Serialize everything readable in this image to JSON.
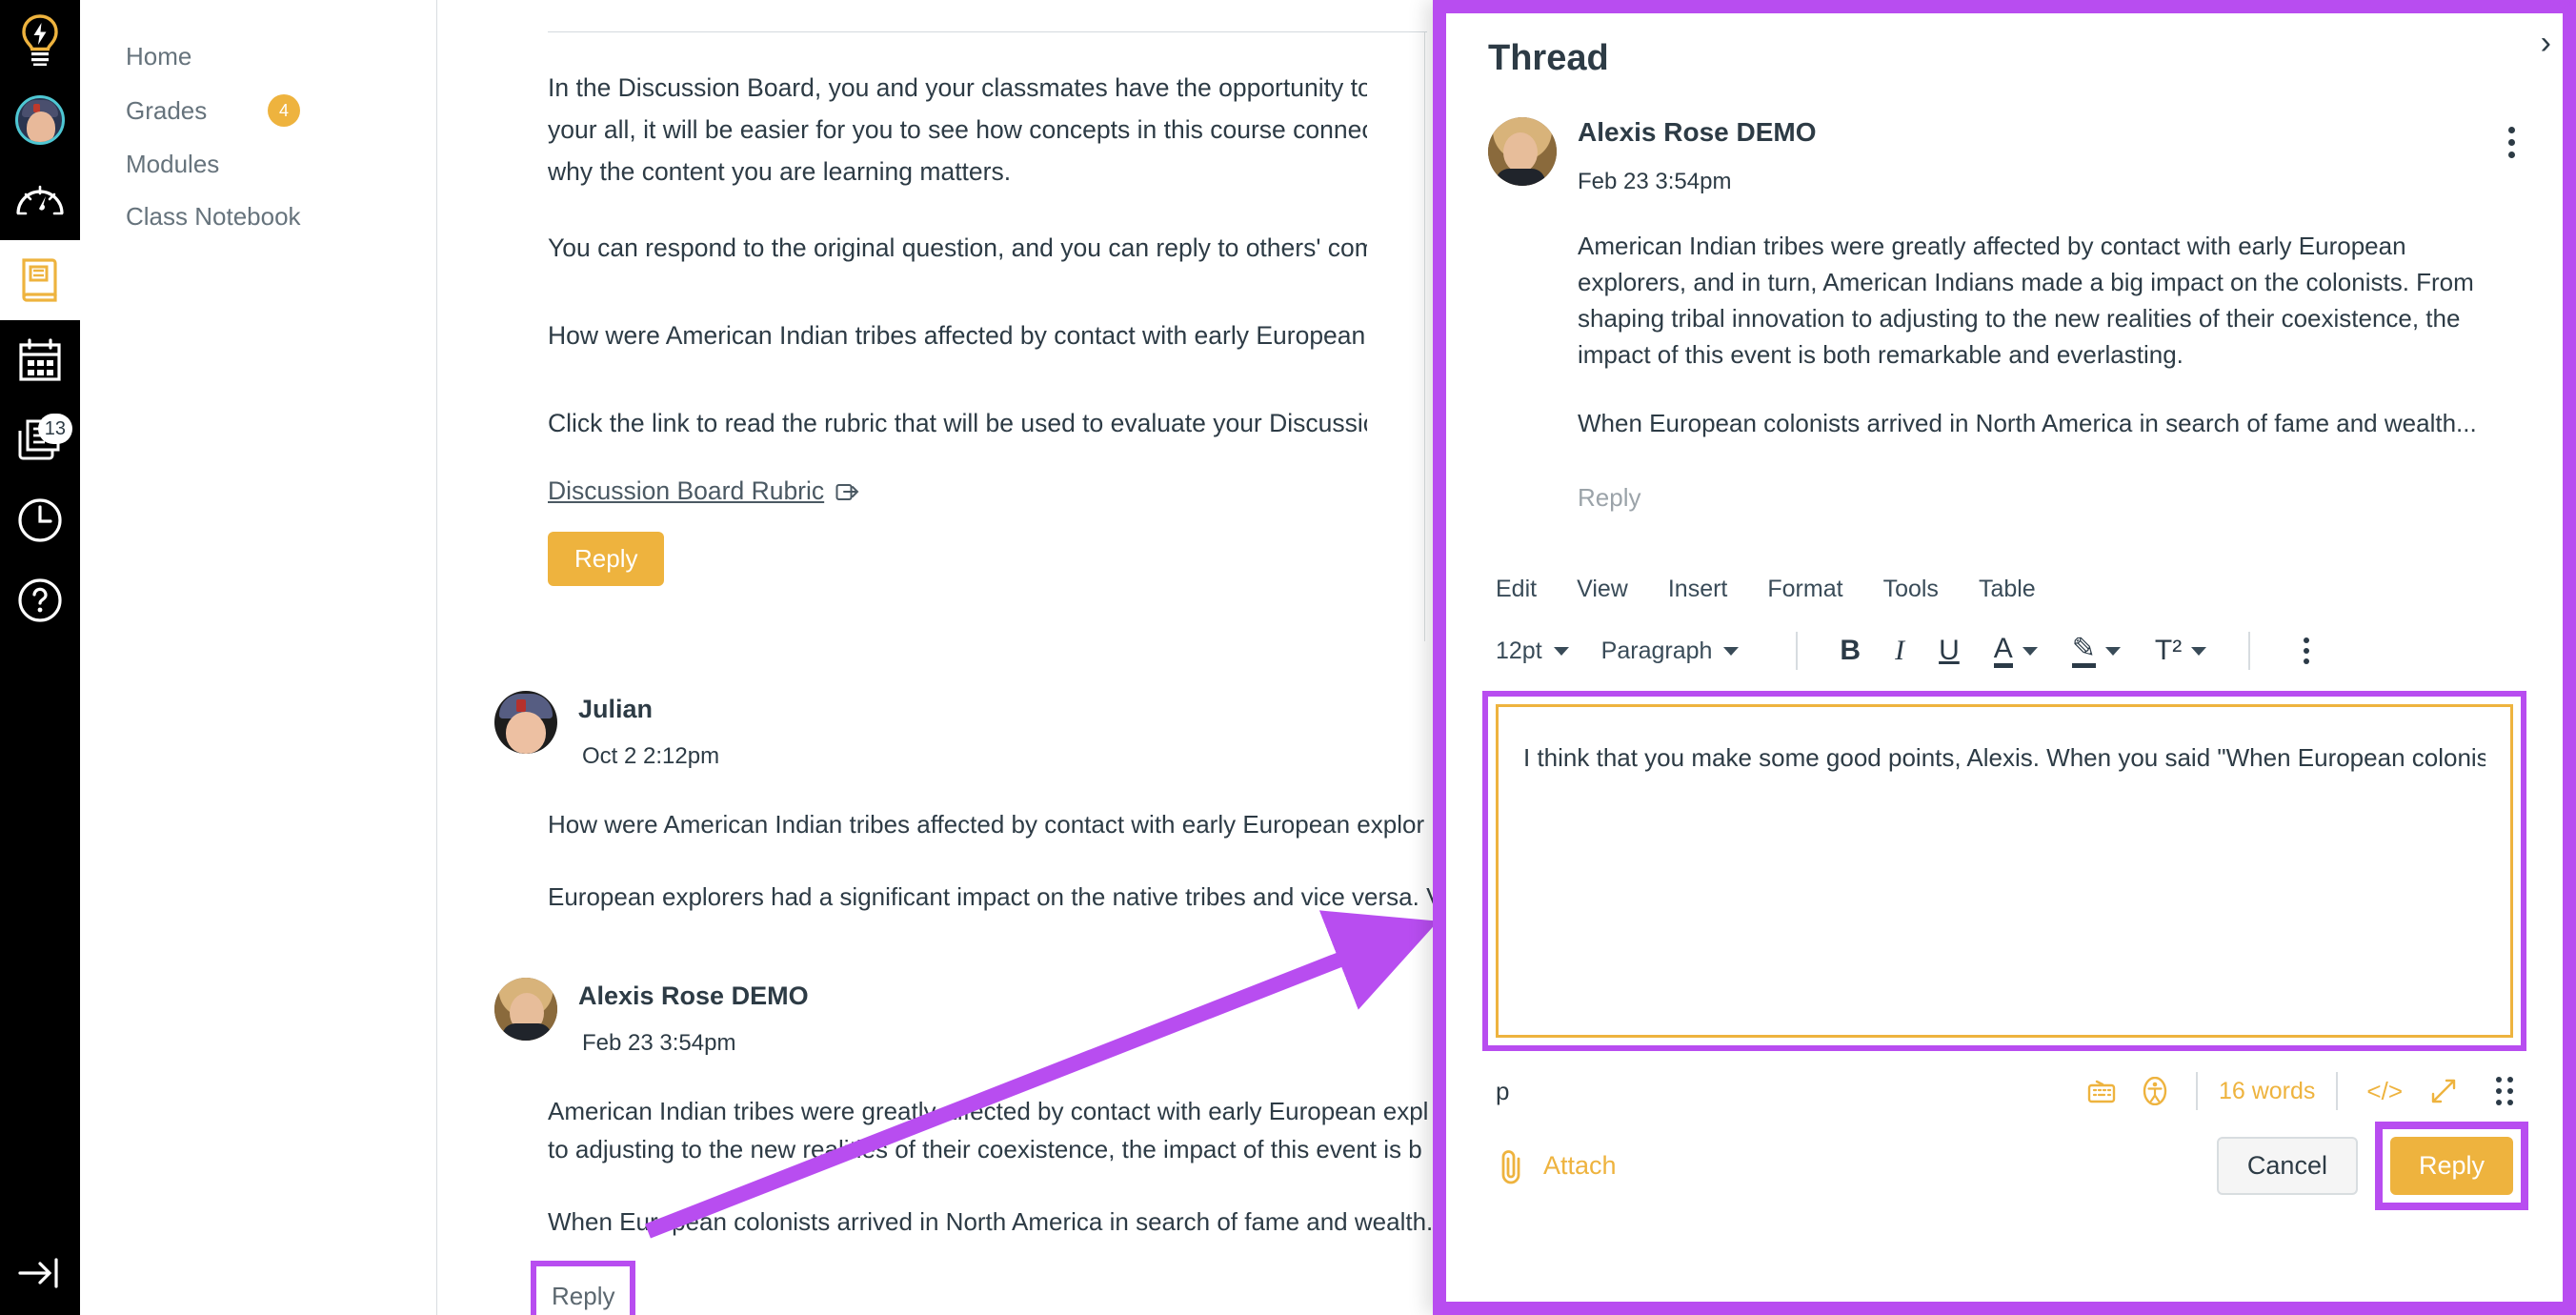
{
  "global_nav": {
    "items": [
      {
        "name": "dashboard-lightbulb-icon",
        "label": "Dashboard",
        "badge": null,
        "active": false
      },
      {
        "name": "account-avatar",
        "label": "Account",
        "badge": null,
        "active": false
      },
      {
        "name": "speedometer-icon",
        "label": "Dashboard",
        "badge": null,
        "active": false
      },
      {
        "name": "courses-book-icon",
        "label": "Courses",
        "badge": null,
        "active": true
      },
      {
        "name": "calendar-icon",
        "label": "Calendar",
        "badge": null,
        "active": false
      },
      {
        "name": "inbox-icon",
        "label": "Inbox",
        "badge": "13",
        "active": false
      },
      {
        "name": "history-clock-icon",
        "label": "History",
        "badge": null,
        "active": false
      },
      {
        "name": "help-question-icon",
        "label": "Help",
        "badge": null,
        "active": false
      }
    ],
    "collapse_label": "Minimize Navigation"
  },
  "course_nav": {
    "items": [
      {
        "label": "Home",
        "badge": null
      },
      {
        "label": "Grades",
        "badge": "4"
      },
      {
        "label": "Modules",
        "badge": null
      },
      {
        "label": "Class Notebook",
        "badge": null
      }
    ]
  },
  "topic": {
    "paragraphs": [
      "In the Discussion Board, you and your classmates have the opportunity to share though",
      "your all, it will be easier for you to see how concepts in this course connect to a variety",
      "why the content you are learning matters.",
      "You can respond to the original question, and you can reply to others' comments. Please",
      "How were American Indian tribes affected by contact with early European explorers? H",
      "Click the link to read the rubric that will be used to evaluate your Discussion Board post"
    ],
    "rubric_link": "Discussion Board Rubric",
    "reply_button": "Reply"
  },
  "entries": [
    {
      "author": "Julian",
      "date": "Oct 2 2:12pm",
      "avatar": "julian-avatar",
      "paragraphs": [
        "How were American Indian tribes affected by contact with early European explor",
        "European explorers had a significant impact on the native tribes and vice versa. V"
      ],
      "reply_label": null
    },
    {
      "author": "Alexis Rose DEMO",
      "date": "Feb 23 3:54pm",
      "avatar": "alexis-avatar",
      "paragraphs": [
        "American Indian tribes were greatly affected by contact with early European expl",
        "to adjusting to the new realities of their coexistence, the impact of this event is b",
        "When European colonists arrived in North America in search of fame and wealth."
      ],
      "reply_label": "Reply"
    }
  ],
  "thread_panel": {
    "title": "Thread",
    "close_icon": "›",
    "post": {
      "author": "Alexis Rose DEMO",
      "date": "Feb 23 3:54pm",
      "paragraphs": [
        "American Indian tribes were greatly affected by contact with early European explorers, and in turn, American Indians made a big impact on the colonists. From shaping tribal innovation to adjusting to the new realities of their coexistence, the impact of this event is both remarkable and everlasting.",
        "When European colonists arrived in North America in search of fame and wealth..."
      ],
      "reply_label": "Reply",
      "kebab_name": "post-options-menu"
    },
    "editor": {
      "menubar": [
        "Edit",
        "View",
        "Insert",
        "Format",
        "Tools",
        "Table"
      ],
      "font_size": "12pt",
      "block_format": "Paragraph",
      "buttons": [
        {
          "name": "bold-icon",
          "glyph": "B"
        },
        {
          "name": "italic-icon",
          "glyph": "I"
        },
        {
          "name": "underline-icon",
          "glyph": "U"
        },
        {
          "name": "text-color-icon",
          "glyph": "A"
        },
        {
          "name": "highlight-color-icon",
          "glyph": "✎"
        },
        {
          "name": "superscript-icon",
          "glyph": "T²"
        }
      ],
      "overflow_label": "More",
      "content": "I think that you make some good points, Alexis. When you said \"When European colonists arr...",
      "status_path": "p",
      "word_count": "16 words",
      "status_icons": [
        {
          "name": "keyboard-shortcuts-icon",
          "glyph": "⌨"
        },
        {
          "name": "accessibility-checker-icon",
          "glyph": "Ⓔ"
        },
        {
          "name": "html-editor-icon",
          "glyph": "</>"
        },
        {
          "name": "fullscreen-icon",
          "glyph": "↗"
        },
        {
          "name": "resize-handle-icon",
          "glyph": "⋮⋮"
        }
      ]
    },
    "actions": {
      "attach_label": "Attach",
      "attach_icon": "paperclip-icon",
      "cancel_label": "Cancel",
      "reply_label": "Reply"
    }
  },
  "colors": {
    "brand_yellow": "#eeb33e",
    "highlight_purple": "#b84df0",
    "nav_black": "#000000",
    "text_dark": "#2d3b45",
    "text_muted": "#66737c"
  }
}
